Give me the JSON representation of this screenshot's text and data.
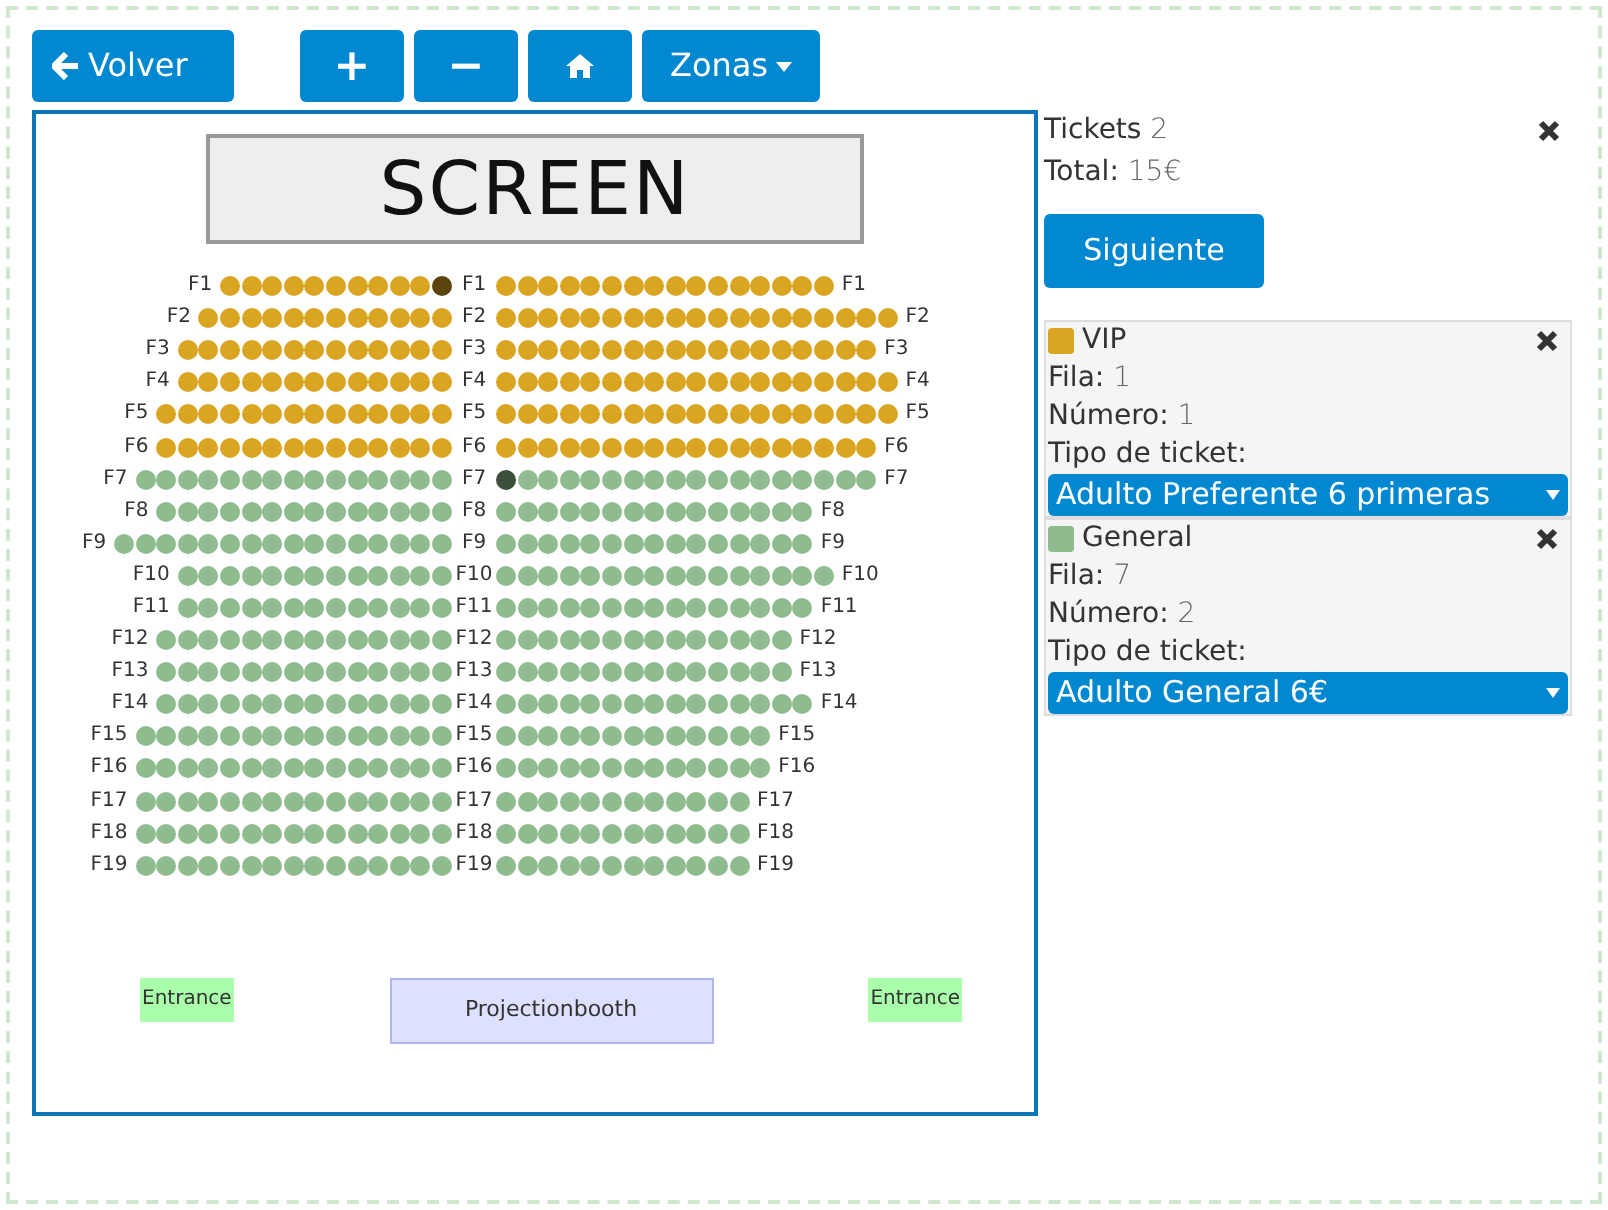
{
  "toolbar": {
    "back_button": "Volver",
    "zoom_in_button": "+",
    "zoom_out_button": "−",
    "zones_button": "Zonas"
  },
  "plan": {
    "screen": "SCREEN",
    "rows": [
      {
        "labels": [
          "F1",
          "F1",
          "F1"
        ],
        "color": "#daa520",
        "left": [
          false,
          false,
          false,
          false,
          false,
          false,
          false,
          false,
          false,
          false,
          true
        ],
        "right": [
          false,
          false,
          false,
          false,
          false,
          false,
          false,
          false,
          false,
          false,
          false,
          false,
          false,
          false,
          false,
          false
        ]
      },
      {
        "labels": [
          "F2",
          "F2",
          "F2"
        ],
        "color": "#daa520",
        "left": [
          false,
          false,
          false,
          false,
          false,
          false,
          false,
          false,
          false,
          false,
          false,
          false
        ],
        "right": [
          false,
          false,
          false,
          false,
          false,
          false,
          false,
          false,
          false,
          false,
          false,
          false,
          false,
          false,
          false,
          false,
          false,
          false,
          false
        ]
      },
      {
        "labels": [
          "F3",
          "F3",
          "F3"
        ],
        "color": "#daa520",
        "left": [
          false,
          false,
          false,
          false,
          false,
          false,
          false,
          false,
          false,
          false,
          false,
          false,
          false
        ],
        "right": [
          false,
          false,
          false,
          false,
          false,
          false,
          false,
          false,
          false,
          false,
          false,
          false,
          false,
          false,
          false,
          false,
          false,
          false
        ]
      },
      {
        "labels": [
          "F4",
          "F4",
          "F4"
        ],
        "color": "#daa520",
        "left": [
          false,
          false,
          false,
          false,
          false,
          false,
          false,
          false,
          false,
          false,
          false,
          false,
          false
        ],
        "right": [
          false,
          false,
          false,
          false,
          false,
          false,
          false,
          false,
          false,
          false,
          false,
          false,
          false,
          false,
          false,
          false,
          false,
          false,
          false
        ]
      },
      {
        "labels": [
          "F5",
          "F5",
          "F5"
        ],
        "color": "#daa520",
        "left": [
          false,
          false,
          false,
          false,
          false,
          false,
          false,
          false,
          false,
          false,
          false,
          false,
          false,
          false
        ],
        "right": [
          false,
          false,
          false,
          false,
          false,
          false,
          false,
          false,
          false,
          false,
          false,
          false,
          false,
          false,
          false,
          false,
          false,
          false,
          false
        ]
      },
      {
        "labels": [
          "F6",
          "F6",
          "F6"
        ],
        "color": "#daa520",
        "left": [
          false,
          false,
          false,
          false,
          false,
          false,
          false,
          false,
          false,
          false,
          false,
          false,
          false,
          false
        ],
        "right": [
          false,
          false,
          false,
          false,
          false,
          false,
          false,
          false,
          false,
          false,
          false,
          false,
          false,
          false,
          false,
          false,
          false,
          false
        ]
      },
      {
        "labels": [
          "F7",
          "F7",
          "F7"
        ],
        "color": "#8fbc8f",
        "left": [
          false,
          false,
          false,
          false,
          false,
          false,
          false,
          false,
          false,
          false,
          false,
          false,
          false,
          false,
          false
        ],
        "right": [
          true,
          false,
          false,
          false,
          false,
          false,
          false,
          false,
          false,
          false,
          false,
          false,
          false,
          false,
          false,
          false,
          false,
          false
        ]
      },
      {
        "labels": [
          "F8",
          "F8",
          "F8"
        ],
        "color": "#8fbc8f",
        "left": [
          false,
          false,
          false,
          false,
          false,
          false,
          false,
          false,
          false,
          false,
          false,
          false,
          false,
          false
        ],
        "right": [
          false,
          false,
          false,
          false,
          false,
          false,
          false,
          false,
          false,
          false,
          false,
          false,
          false,
          false,
          false
        ]
      },
      {
        "labels": [
          "F9",
          "F9",
          "F9"
        ],
        "color": "#8fbc8f",
        "left": [
          false,
          false,
          false,
          false,
          false,
          false,
          false,
          false,
          false,
          false,
          false,
          false,
          false,
          false,
          false,
          false
        ],
        "right": [
          false,
          false,
          false,
          false,
          false,
          false,
          false,
          false,
          false,
          false,
          false,
          false,
          false,
          false,
          false
        ]
      },
      {
        "labels": [
          "F10",
          "F10",
          "F10"
        ],
        "color": "#8fbc8f",
        "left": [
          false,
          false,
          false,
          false,
          false,
          false,
          false,
          false,
          false,
          false,
          false,
          false,
          false
        ],
        "right": [
          false,
          false,
          false,
          false,
          false,
          false,
          false,
          false,
          false,
          false,
          false,
          false,
          false,
          false,
          false,
          false
        ]
      },
      {
        "labels": [
          "F11",
          "F11",
          "F11"
        ],
        "color": "#8fbc8f",
        "left": [
          false,
          false,
          false,
          false,
          false,
          false,
          false,
          false,
          false,
          false,
          false,
          false,
          false
        ],
        "right": [
          false,
          false,
          false,
          false,
          false,
          false,
          false,
          false,
          false,
          false,
          false,
          false,
          false,
          false,
          false
        ]
      },
      {
        "labels": [
          "F12",
          "F12",
          "F12"
        ],
        "color": "#8fbc8f",
        "left": [
          false,
          false,
          false,
          false,
          false,
          false,
          false,
          false,
          false,
          false,
          false,
          false,
          false,
          false
        ],
        "right": [
          false,
          false,
          false,
          false,
          false,
          false,
          false,
          false,
          false,
          false,
          false,
          false,
          false,
          false
        ]
      },
      {
        "labels": [
          "F13",
          "F13",
          "F13"
        ],
        "color": "#8fbc8f",
        "left": [
          false,
          false,
          false,
          false,
          false,
          false,
          false,
          false,
          false,
          false,
          false,
          false,
          false,
          false
        ],
        "right": [
          false,
          false,
          false,
          false,
          false,
          false,
          false,
          false,
          false,
          false,
          false,
          false,
          false,
          false
        ]
      },
      {
        "labels": [
          "F14",
          "F14",
          "F14"
        ],
        "color": "#8fbc8f",
        "left": [
          false,
          false,
          false,
          false,
          false,
          false,
          false,
          false,
          false,
          false,
          false,
          false,
          false,
          false
        ],
        "right": [
          false,
          false,
          false,
          false,
          false,
          false,
          false,
          false,
          false,
          false,
          false,
          false,
          false,
          false,
          false
        ]
      },
      {
        "labels": [
          "F15",
          "F15",
          "F15"
        ],
        "color": "#8fbc8f",
        "left": [
          false,
          false,
          false,
          false,
          false,
          false,
          false,
          false,
          false,
          false,
          false,
          false,
          false,
          false,
          false
        ],
        "right": [
          false,
          false,
          false,
          false,
          false,
          false,
          false,
          false,
          false,
          false,
          false,
          false,
          false
        ]
      },
      {
        "labels": [
          "F16",
          "F16",
          "F16"
        ],
        "color": "#8fbc8f",
        "left": [
          false,
          false,
          false,
          false,
          false,
          false,
          false,
          false,
          false,
          false,
          false,
          false,
          false,
          false,
          false
        ],
        "right": [
          false,
          false,
          false,
          false,
          false,
          false,
          false,
          false,
          false,
          false,
          false,
          false,
          false
        ]
      },
      {
        "labels": [
          "F17",
          "F17",
          "F17"
        ],
        "color": "#8fbc8f",
        "left": [
          false,
          false,
          false,
          false,
          false,
          false,
          false,
          false,
          false,
          false,
          false,
          false,
          false,
          false,
          false
        ],
        "right": [
          false,
          false,
          false,
          false,
          false,
          false,
          false,
          false,
          false,
          false,
          false,
          false
        ]
      },
      {
        "labels": [
          "F18",
          "F18",
          "F18"
        ],
        "color": "#8fbc8f",
        "left": [
          false,
          false,
          false,
          false,
          false,
          false,
          false,
          false,
          false,
          false,
          false,
          false,
          false,
          false,
          false
        ],
        "right": [
          false,
          false,
          false,
          false,
          false,
          false,
          false,
          false,
          false,
          false,
          false,
          false
        ]
      },
      {
        "labels": [
          "F19",
          "F19",
          "F19"
        ],
        "color": "#8fbc8f",
        "left": [
          false,
          false,
          false,
          false,
          false,
          false,
          false,
          false,
          false,
          false,
          false,
          false,
          false,
          false,
          false
        ],
        "right": [
          false,
          false,
          false,
          false,
          false,
          false,
          false,
          false,
          false,
          false,
          false,
          false
        ]
      }
    ],
    "areas": [
      {
        "kind": "entrance",
        "label": "Entrance"
      },
      {
        "kind": "booth",
        "label": "Projectionbooth"
      },
      {
        "kind": "entrance",
        "label": "Entrance"
      }
    ]
  },
  "summary": {
    "tickets_label": "Tickets",
    "tickets_count": "2",
    "total_label": "Total:",
    "total_value": "15€",
    "next_button": "Siguiente"
  },
  "tickets": [
    {
      "zone": "VIP",
      "color": "#daa520",
      "row_label": "Fila:",
      "row": "1",
      "number_label": "Número:",
      "number": "1",
      "type_label": "Tipo de ticket:",
      "type": "Adulto Preferente 6 primeras"
    },
    {
      "zone": "General",
      "color": "#8fbc8f",
      "row_label": "Fila:",
      "row": "7",
      "number_label": "Número:",
      "number": "2",
      "type_label": "Tipo de ticket:",
      "type": "Adulto General 6€"
    }
  ]
}
